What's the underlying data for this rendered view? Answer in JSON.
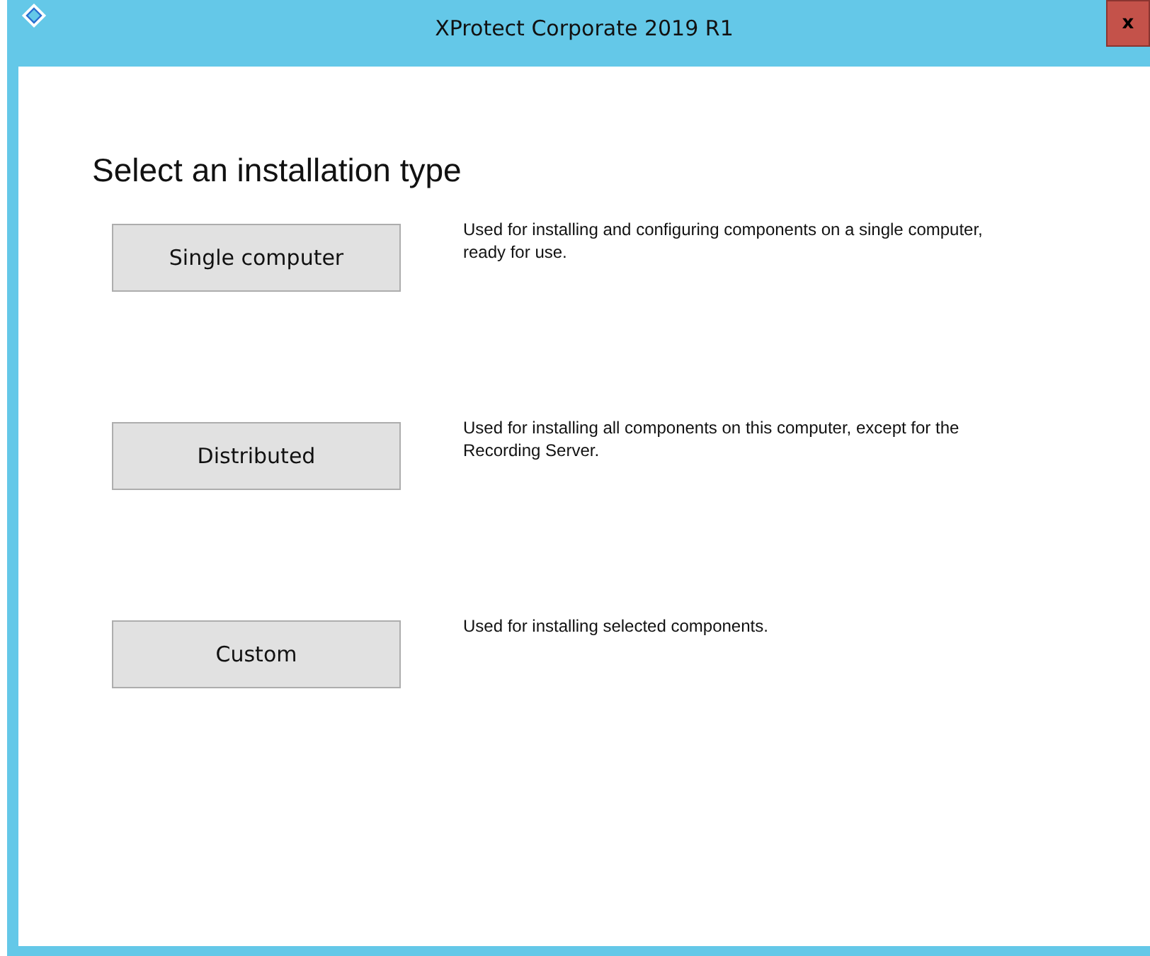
{
  "window": {
    "title": "XProtect Corporate 2019 R1",
    "close": "x"
  },
  "heading": "Select an installation type",
  "options": [
    {
      "label": "Single computer",
      "description": "Used for installing and configuring components on a single computer, ready for use."
    },
    {
      "label": "Distributed",
      "description": "Used for installing all components on this computer, except for the Recording Server."
    },
    {
      "label": "Custom",
      "description": "Used for installing selected components."
    }
  ]
}
